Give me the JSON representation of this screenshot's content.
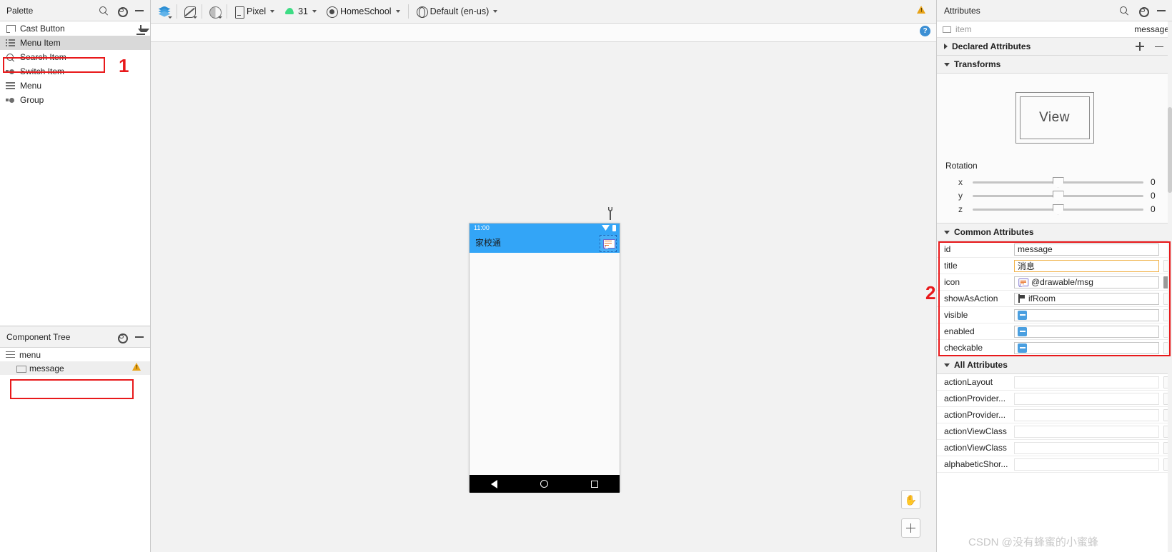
{
  "palette": {
    "title": "Palette",
    "tools": [
      "search-icon",
      "gear-icon",
      "minimize-icon"
    ],
    "download_icon": "download-icon",
    "items": [
      {
        "label": "Cast Button",
        "icon": "cast-icon",
        "selected": false
      },
      {
        "label": "Menu Item",
        "icon": "menu-item-icon",
        "selected": true
      },
      {
        "label": "Search Item",
        "icon": "search-icon",
        "selected": false
      },
      {
        "label": "Switch Item",
        "icon": "switch-icon",
        "selected": false
      },
      {
        "label": "Menu",
        "icon": "menu-icon",
        "selected": false
      },
      {
        "label": "Group",
        "icon": "group-icon",
        "selected": false
      }
    ],
    "annotation_marker": "1"
  },
  "component_tree": {
    "title": "Component Tree",
    "tools": [
      "gear-icon",
      "minimize-icon"
    ],
    "nodes": [
      {
        "label": "menu",
        "icon": "menu-icon",
        "selected": false,
        "warning": false
      },
      {
        "label": "message",
        "icon": "item-icon",
        "selected": true,
        "warning": true
      }
    ]
  },
  "toolbar": {
    "mode_buttons": [
      {
        "name": "design-surface-layers",
        "icon": "layers-icon"
      },
      {
        "name": "orientation-toggle",
        "icon": "rotate-icon"
      },
      {
        "name": "theme-toggle",
        "icon": "half-circle-icon"
      }
    ],
    "device": {
      "label": "Pixel",
      "icon": "device-icon"
    },
    "api_level": {
      "label": "31",
      "icon": "android-icon"
    },
    "theme": {
      "label": "HomeSchool",
      "icon": "theme-icon"
    },
    "locale": {
      "label": "Default (en-us)",
      "icon": "globe-icon"
    },
    "warning_icon": "warning-triangle-icon",
    "help_icon": "help-icon"
  },
  "canvas": {
    "wrench_icon": "wrench-icon",
    "pan_button": "pan-hand-icon",
    "zoom_in_button": "plus-icon",
    "preview": {
      "status_time": "11:00",
      "status_icons": [
        "wifi-icon",
        "battery-icon"
      ],
      "app_bar_title": "家校通",
      "action_item_icon": "message-icon",
      "nav_buttons": [
        "back-triangle-icon",
        "home-circle-icon",
        "recents-square-icon"
      ]
    }
  },
  "attributes": {
    "title": "Attributes",
    "tools": [
      "search-icon",
      "gear-icon",
      "minimize-icon"
    ],
    "selection": {
      "type_icon": "item-icon",
      "type": "item",
      "value": "message"
    },
    "sections": {
      "declared": {
        "label": "Declared Attributes",
        "expanded": false,
        "add": "+",
        "remove": "−"
      },
      "transforms": {
        "label": "Transforms",
        "expanded": true
      },
      "common": {
        "label": "Common Attributes",
        "expanded": true
      },
      "all": {
        "label": "All Attributes",
        "expanded": true
      }
    },
    "transforms": {
      "preview_label": "View",
      "rotation_label": "Rotation",
      "axes": [
        {
          "axis": "x",
          "value": "0"
        },
        {
          "axis": "y",
          "value": "0"
        },
        {
          "axis": "z",
          "value": "0"
        }
      ]
    },
    "common_attributes": [
      {
        "key": "id",
        "value": "message",
        "kind": "text",
        "focus": false,
        "scroll": "none"
      },
      {
        "key": "title",
        "value": "消息",
        "kind": "text",
        "focus": true,
        "scroll": "off"
      },
      {
        "key": "icon",
        "value": "@drawable/msg",
        "kind": "resource",
        "icon": "message-icon",
        "focus": false,
        "scroll": "on"
      },
      {
        "key": "showAsAction",
        "value": "ifRoom",
        "kind": "flag",
        "icon": "flag-icon",
        "focus": false,
        "scroll": "off"
      },
      {
        "key": "visible",
        "value": "",
        "kind": "checkbox",
        "focus": false,
        "scroll": "off"
      },
      {
        "key": "enabled",
        "value": "",
        "kind": "checkbox",
        "focus": false,
        "scroll": "off"
      },
      {
        "key": "checkable",
        "value": "",
        "kind": "checkbox",
        "focus": false,
        "scroll": "off"
      }
    ],
    "annotation_marker": "2",
    "all_attributes": [
      {
        "key": "actionLayout",
        "value": ""
      },
      {
        "key": "actionProvider...",
        "value": ""
      },
      {
        "key": "actionProvider...",
        "value": ""
      },
      {
        "key": "actionViewClass",
        "value": ""
      },
      {
        "key": "actionViewClass",
        "value": ""
      },
      {
        "key": "alphabeticShor...",
        "value": ""
      }
    ]
  },
  "watermark": "CSDN @没有蜂蜜的小蜜蜂"
}
